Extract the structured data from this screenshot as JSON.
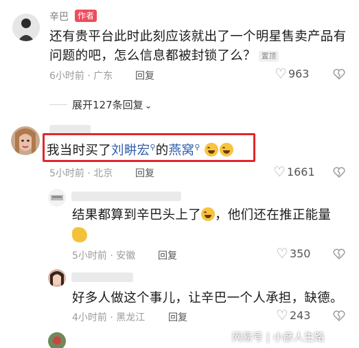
{
  "comments": [
    {
      "name": "辛巴",
      "badge": "作者",
      "text": "还有贵平台此时此刻应该就出了一个明星售卖产品有问题的吧，怎么信息都被封锁了么？",
      "pinned": "置顶",
      "time": "6小时前 · 广东",
      "reply": "回复",
      "likes": "963"
    },
    {
      "expand": "展开127条回复"
    },
    {
      "text_before": "我当时买了",
      "mention1": "刘畊宏",
      "text_mid": "的",
      "mention2": "燕窝",
      "time": "5小时前 · 北京",
      "reply": "回复",
      "likes": "1661"
    },
    {
      "text": "结果都算到辛巴头上了",
      "text_after": "，他们还在推正能量",
      "time": "5小时前 · 安徽",
      "reply": "回复",
      "likes": "350"
    },
    {
      "text": "好多人做这个事儿，让辛巴一个人承担，缺德。",
      "time": "4小时前 · 黑龙江",
      "reply": "回复",
      "likes": "243"
    }
  ],
  "watermark": "网易号 | 小彦人生路",
  "colors": {
    "highlight": "#e0262c",
    "mention": "#2f5ea8",
    "badge": "#f04a5d"
  }
}
